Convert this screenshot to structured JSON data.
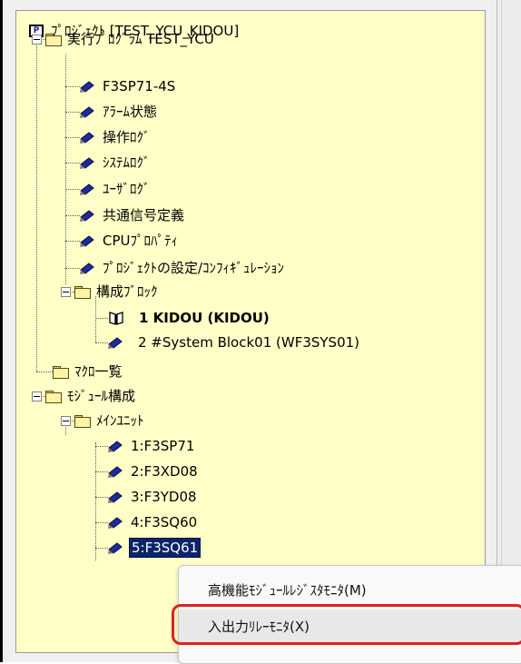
{
  "tree": {
    "project": "ﾌﾟﾛｼﾞｪｸﾄ [TEST_YCU_KIDOU]",
    "program_folder": "実行ﾌﾟﾛｸﾞﾗﾑ TEST_YCU",
    "program_items": [
      "F3SP71-4S",
      "ｱﾗｰﾑ状態",
      "操作ﾛｸﾞ",
      "ｼｽﾃﾑﾛｸﾞ",
      "ﾕｰｻﾞﾛｸﾞ",
      "共通信号定義",
      "CPUﾌﾟﾛﾊﾟﾃｨ",
      "ﾌﾟﾛｼﾞｪｸﾄの設定/ｺﾝﾌｨｷﾞｭﾚｰｼｮﾝ"
    ],
    "block_folder": "構成ﾌﾞﾛｯｸ",
    "blocks": [
      "1 KIDOU (KIDOU)",
      "2 #System Block01 (WF3SYS01)"
    ],
    "macro_folder": "ﾏｸﾛ一覧",
    "module_folder": "ﾓｼﾞｭｰﾙ構成",
    "main_unit_folder": "ﾒｲﾝﾕﾆｯﾄ",
    "modules": [
      "1:F3SP71",
      "2:F3XD08",
      "3:F3YD08",
      "4:F3SQ60",
      "5:F3SQ61"
    ]
  },
  "context_menu": {
    "items": [
      "高機能ﾓｼﾞｭｰﾙﾚｼﾞｽﾀﾓﾆﾀ(M)",
      "入出力ﾘﾚｰﾓﾆﾀ(X)"
    ],
    "highlighted": "入出力ﾘﾚｰﾓﾆﾀ(X)"
  },
  "colors": {
    "tree_background": "#ffffc8",
    "selection": "#0b246a",
    "highlight_border": "#e02020"
  }
}
